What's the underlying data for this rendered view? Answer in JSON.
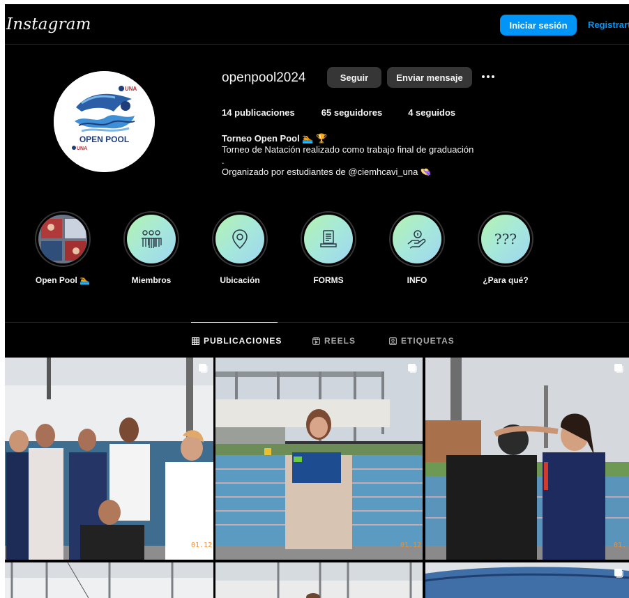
{
  "header": {
    "logo": "Instagram",
    "login_label": "Iniciar sesión",
    "register_label": "Registrarte"
  },
  "profile": {
    "username": "openpool2024",
    "follow_label": "Seguir",
    "message_label": "Enviar mensaje",
    "stats": {
      "posts": "14 publicaciones",
      "followers": "65 seguidores",
      "following": "4 seguidos"
    },
    "bio": {
      "name": "Torneo Open Pool 🏊 🏆",
      "line1": "Torneo de Natación realizado como trabajo final de graduación",
      "line2": ".",
      "line3": "Organizado por estudiantes de @ciemhcavi_una 👒"
    },
    "avatar_text": {
      "badge": "UNA",
      "title": "OPEN POOL",
      "sub": "UNA"
    }
  },
  "highlights": [
    {
      "label": "Open Pool 🏊",
      "icon": "photo-collage"
    },
    {
      "label": "Miembros",
      "icon": "people-group-icon"
    },
    {
      "label": "Ubicación",
      "icon": "location-pin-icon"
    },
    {
      "label": "FORMS",
      "icon": "document-icon"
    },
    {
      "label": "INFO",
      "icon": "hand-coin-icon"
    },
    {
      "label": "¿Para qué?",
      "icon": "???"
    }
  ],
  "tabs": {
    "posts": "PUBLICACIONES",
    "reels": "REELS",
    "tagged": "ETIQUETAS"
  },
  "posts": [
    {
      "stamp": "01.12",
      "multi": true
    },
    {
      "stamp": "01.12",
      "multi": true
    },
    {
      "stamp": "01.",
      "multi": true
    },
    {
      "stamp": "",
      "multi": false
    },
    {
      "stamp": "",
      "multi": false
    },
    {
      "stamp": "",
      "multi": true
    }
  ],
  "colors": {
    "background": "#000000",
    "accent": "#0095f6",
    "secondary_button": "#363636",
    "highlight_gradient_start": "#b4f3b0",
    "highlight_gradient_end": "#9ed6f0"
  }
}
